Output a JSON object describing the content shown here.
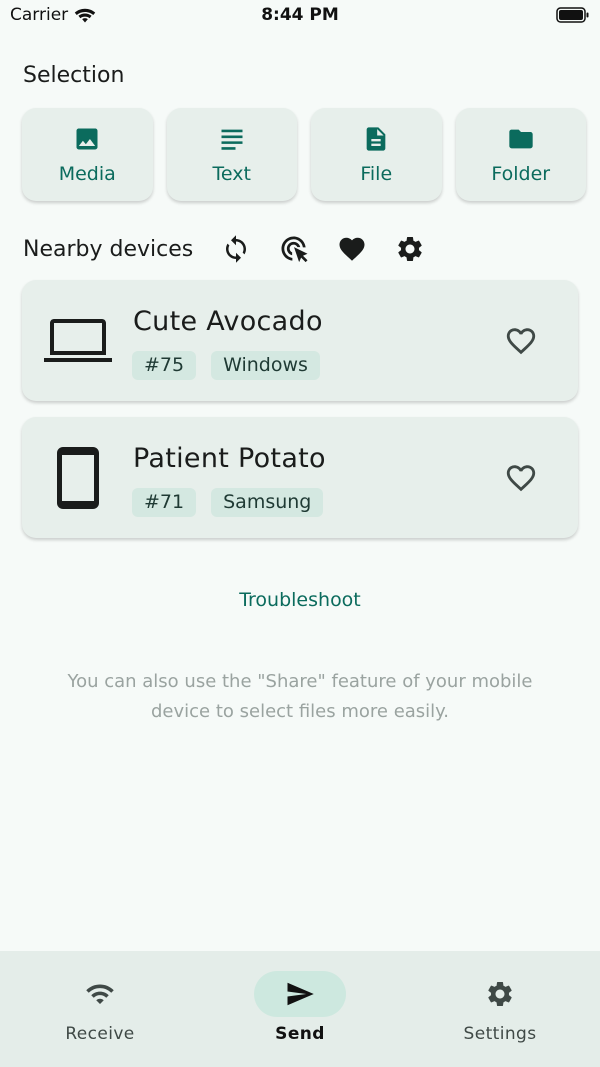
{
  "status": {
    "carrier": "Carrier",
    "time": "8:44 PM"
  },
  "selection": {
    "title": "Selection",
    "buttons": [
      {
        "label": "Media",
        "icon": "image-icon"
      },
      {
        "label": "Text",
        "icon": "text-lines-icon"
      },
      {
        "label": "File",
        "icon": "file-icon"
      },
      {
        "label": "Folder",
        "icon": "folder-icon"
      }
    ]
  },
  "nearby": {
    "title": "Nearby devices",
    "tools": [
      "refresh-icon",
      "target-cursor-icon",
      "heart-filled-icon",
      "gear-icon"
    ],
    "devices": [
      {
        "name": "Cute Avocado",
        "tag_id": "#75",
        "tag_type": "Windows",
        "icon": "laptop-icon"
      },
      {
        "name": "Patient Potato",
        "tag_id": "#71",
        "tag_type": "Samsung",
        "icon": "phone-icon"
      }
    ]
  },
  "troubleshoot": "Troubleshoot",
  "hint": "You can also use the \"Share\" feature of your mobile device to select files more easily.",
  "nav": {
    "items": [
      {
        "label": "Receive",
        "icon": "wifi-icon",
        "active": false
      },
      {
        "label": "Send",
        "icon": "send-icon",
        "active": true
      },
      {
        "label": "Settings",
        "icon": "gear-icon",
        "active": false
      }
    ]
  },
  "colors": {
    "accent": "#0b6b5d",
    "card": "#e7efeb",
    "tag": "#d4e8e1",
    "background": "#f6faf8",
    "nav_active": "#cde8df"
  }
}
